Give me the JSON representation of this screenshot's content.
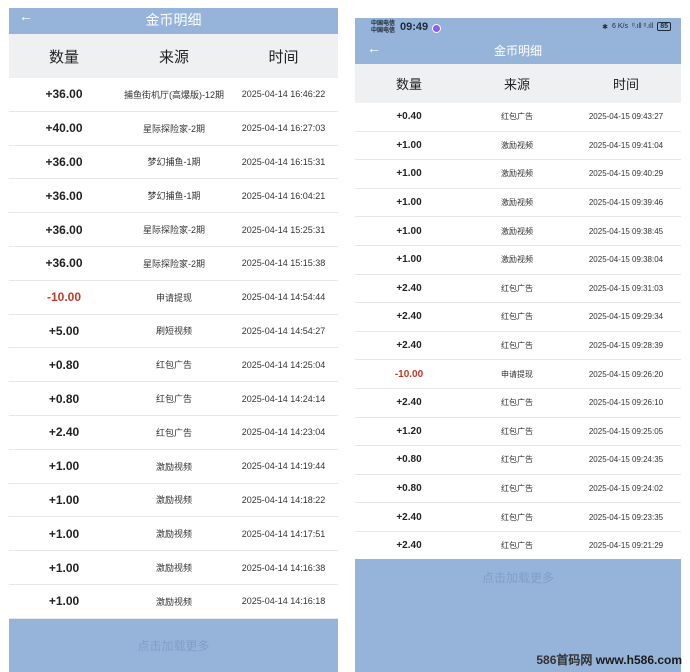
{
  "left": {
    "title": "金币明细",
    "back_icon": "←",
    "headers": {
      "amount": "数量",
      "source": "来源",
      "time": "时间"
    },
    "rows": [
      {
        "amount": "+36.00",
        "source": "捕鱼街机厅(高爆版)-12期",
        "time": "2025-04-14 16:46:22",
        "negative": false
      },
      {
        "amount": "+40.00",
        "source": "星际探险家-2期",
        "time": "2025-04-14 16:27:03",
        "negative": false
      },
      {
        "amount": "+36.00",
        "source": "梦幻捕鱼-1期",
        "time": "2025-04-14 16:15:31",
        "negative": false
      },
      {
        "amount": "+36.00",
        "source": "梦幻捕鱼-1期",
        "time": "2025-04-14 16:04:21",
        "negative": false
      },
      {
        "amount": "+36.00",
        "source": "星际探险家-2期",
        "time": "2025-04-14 15:25:31",
        "negative": false
      },
      {
        "amount": "+36.00",
        "source": "星际探险家-2期",
        "time": "2025-04-14 15:15:38",
        "negative": false
      },
      {
        "amount": "-10.00",
        "source": "申请提现",
        "time": "2025-04-14 14:54:44",
        "negative": true
      },
      {
        "amount": "+5.00",
        "source": "刷短视频",
        "time": "2025-04-14 14:54:27",
        "negative": false
      },
      {
        "amount": "+0.80",
        "source": "红包广告",
        "time": "2025-04-14 14:25:04",
        "negative": false
      },
      {
        "amount": "+0.80",
        "source": "红包广告",
        "time": "2025-04-14 14:24:14",
        "negative": false
      },
      {
        "amount": "+2.40",
        "source": "红包广告",
        "time": "2025-04-14 14:23:04",
        "negative": false
      },
      {
        "amount": "+1.00",
        "source": "激励视频",
        "time": "2025-04-14 14:19:44",
        "negative": false
      },
      {
        "amount": "+1.00",
        "source": "激励视频",
        "time": "2025-04-14 14:18:22",
        "negative": false
      },
      {
        "amount": "+1.00",
        "source": "激励视频",
        "time": "2025-04-14 14:17:51",
        "negative": false
      },
      {
        "amount": "+1.00",
        "source": "激励视频",
        "time": "2025-04-14 14:16:38",
        "negative": false
      },
      {
        "amount": "+1.00",
        "source": "激励视频",
        "time": "2025-04-14 14:16:18",
        "negative": false
      }
    ],
    "load_more": "点击加载更多"
  },
  "right": {
    "status": {
      "carrier_1": "中国电信",
      "carrier_2": "中国电信",
      "time": "09:49",
      "net_speed": "6 K/s",
      "signal": "ᵗˡ.ıll ᵗˡ.ıll",
      "battery": "85"
    },
    "title": "金币明细",
    "back_icon": "←",
    "headers": {
      "amount": "数量",
      "source": "来源",
      "time": "时间"
    },
    "rows": [
      {
        "amount": "+0.40",
        "source": "红包广告",
        "time": "2025-04-15 09:43:27",
        "negative": false
      },
      {
        "amount": "+1.00",
        "source": "激励视频",
        "time": "2025-04-15 09:41:04",
        "negative": false
      },
      {
        "amount": "+1.00",
        "source": "激励视频",
        "time": "2025-04-15 09:40:29",
        "negative": false
      },
      {
        "amount": "+1.00",
        "source": "激励视频",
        "time": "2025-04-15 09:39:46",
        "negative": false
      },
      {
        "amount": "+1.00",
        "source": "激励视频",
        "time": "2025-04-15 09:38:45",
        "negative": false
      },
      {
        "amount": "+1.00",
        "source": "激励视频",
        "time": "2025-04-15 09:38:04",
        "negative": false
      },
      {
        "amount": "+2.40",
        "source": "红包广告",
        "time": "2025-04-15 09:31:03",
        "negative": false
      },
      {
        "amount": "+2.40",
        "source": "红包广告",
        "time": "2025-04-15 09:29:34",
        "negative": false
      },
      {
        "amount": "+2.40",
        "source": "红包广告",
        "time": "2025-04-15 09:28:39",
        "negative": false
      },
      {
        "amount": "-10.00",
        "source": "申请提现",
        "time": "2025-04-15 09:26:20",
        "negative": true
      },
      {
        "amount": "+2.40",
        "source": "红包广告",
        "time": "2025-04-15 09:26:10",
        "negative": false
      },
      {
        "amount": "+1.20",
        "source": "红包广告",
        "time": "2025-04-15 09:25:05",
        "negative": false
      },
      {
        "amount": "+0.80",
        "source": "红包广告",
        "time": "2025-04-15 09:24:35",
        "negative": false
      },
      {
        "amount": "+0.80",
        "source": "红包广告",
        "time": "2025-04-15 09:24:02",
        "negative": false
      },
      {
        "amount": "+2.40",
        "source": "红包广告",
        "time": "2025-04-15 09:23:35",
        "negative": false
      },
      {
        "amount": "+2.40",
        "source": "红包广告",
        "time": "2025-04-15 09:21:29",
        "negative": false
      }
    ],
    "load_more": "点击加载更多"
  },
  "watermark": {
    "brand": "586首码网",
    "url": "www.h586.com"
  }
}
